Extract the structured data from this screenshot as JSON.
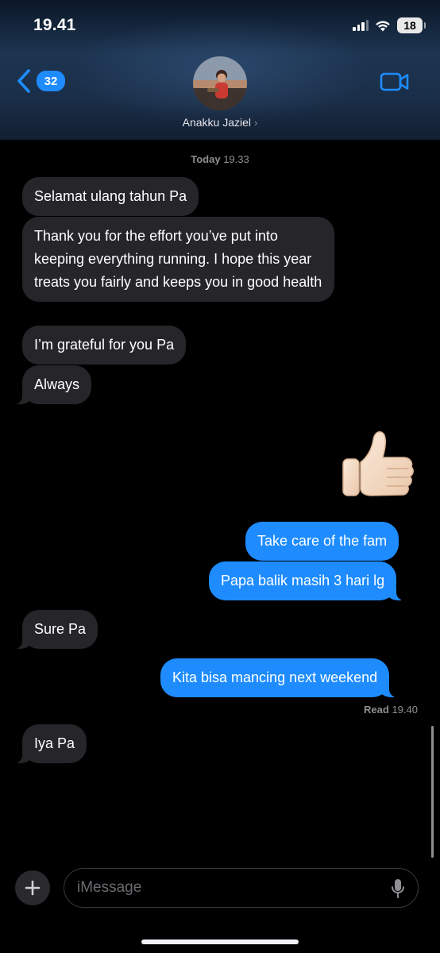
{
  "status_bar": {
    "time": "19.41",
    "battery": "18",
    "signal_icon": "cellular-signal-icon",
    "wifi_icon": "wifi-icon"
  },
  "header": {
    "back_badge": "32",
    "contact_name": "Anakku Jaziel",
    "contact_chevron": "›",
    "video_icon": "video-camera-icon"
  },
  "conversation": {
    "timestamp_day": "Today",
    "timestamp_time": "19.33",
    "messages": [
      {
        "direction": "in",
        "text": "Selamat ulang tahun Pa"
      },
      {
        "direction": "in",
        "text": "Thank you for the effort you’ve put into keeping everything running. I hope this year treats you fairly and keeps you in good health"
      },
      {
        "direction": "in",
        "text": "I’m grateful for you Pa"
      },
      {
        "direction": "in",
        "text": "Always"
      },
      {
        "direction": "out",
        "emoji": "thumbs-up-icon"
      },
      {
        "direction": "out",
        "text": "Take care of the fam"
      },
      {
        "direction": "out",
        "text": "Papa balik masih 3 hari lg"
      },
      {
        "direction": "in",
        "text": "Sure Pa"
      },
      {
        "direction": "out",
        "text": "Kita bisa mancing next weekend"
      },
      {
        "direction": "in",
        "text": "Iya Pa"
      }
    ],
    "read_label": "Read",
    "read_time": "19.40"
  },
  "composer": {
    "placeholder": "iMessage",
    "value": "",
    "plus_icon": "plus-icon",
    "mic_icon": "microphone-icon"
  },
  "colors": {
    "accent": "#1e8cff",
    "incoming_bubble": "#26262a",
    "background": "#000000"
  }
}
